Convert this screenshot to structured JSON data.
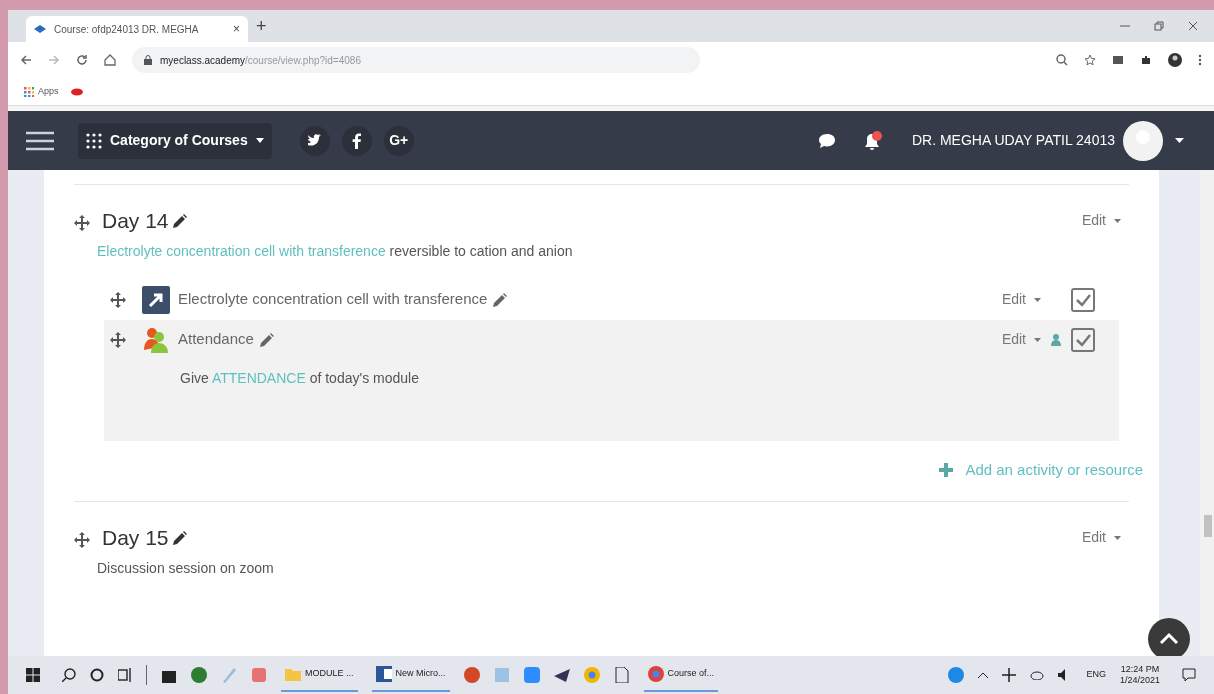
{
  "browser": {
    "tab_title": "Course: ofdp24013 DR. MEGHA",
    "tab_close": "×",
    "new_tab": "+",
    "url_host": "myeclass.academy",
    "url_path": "/course/view.php?id=4086",
    "bookmarks": [
      "Apps"
    ]
  },
  "navbar": {
    "menu_label": "Category of Courses",
    "social": [
      "G+"
    ],
    "user_name": "DR. MEGHA UDAY PATIL 24013"
  },
  "sections": [
    {
      "title": "Day 14",
      "edit": "Edit",
      "summary": [
        {
          "kind": "link",
          "text": "Electrolyte concentration cell with transference"
        },
        {
          "kind": "plain",
          "text": " reversible to cation and anion"
        }
      ],
      "activities": [
        {
          "kind": "url",
          "name": "Electrolyte concentration cell with transference",
          "edit": "Edit",
          "highlighted": false,
          "restricted": false,
          "checked": true
        },
        {
          "kind": "attendance",
          "name": "Attendance",
          "edit": "Edit",
          "highlighted": true,
          "restricted": true,
          "checked": true,
          "description": [
            {
              "kind": "plain",
              "text": "Give "
            },
            {
              "kind": "link",
              "text": "ATTENDANCE"
            },
            {
              "kind": "plain",
              "text": " of today's module"
            }
          ]
        }
      ],
      "add_link": "Add an activity or resource"
    },
    {
      "title": "Day 15",
      "edit": "Edit",
      "summary": [
        {
          "kind": "plain",
          "text": "Discussion session on zoom"
        }
      ]
    }
  ],
  "taskbar": {
    "apps": [
      {
        "label": "MODULE ..."
      },
      {
        "label": "New Micro..."
      },
      {
        "label": "Course of..."
      }
    ],
    "language": "ENG",
    "time": "12:24 PM",
    "date": "1/24/2021"
  }
}
